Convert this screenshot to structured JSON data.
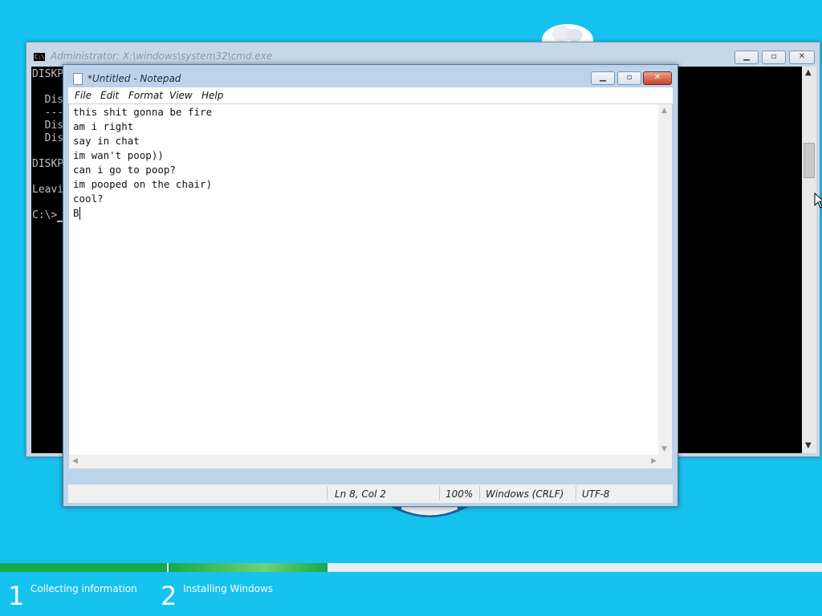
{
  "cmd": {
    "title": "Administrator: X:\\windows\\system32\\cmd.exe",
    "icon": "console-icon",
    "lines": [
      "DISKP",
      "",
      "  Dis",
      "  ---",
      "  Dis",
      "  Dis",
      "",
      "DISKP",
      "",
      "Leavi",
      "",
      "C:\\>"
    ]
  },
  "notepad": {
    "title": "*Untitled - Notepad",
    "menu": [
      "File",
      "Edit",
      "Format",
      "View",
      "Help"
    ],
    "text_lines": [
      "this shit gonna be fire",
      "am i right",
      "say in chat",
      "im wan't poop))",
      "can i go to poop?",
      "im pooped on the chair)",
      "cool?",
      "B"
    ],
    "status": {
      "position": "Ln 8, Col 2",
      "zoom": "100%",
      "line_ending": "Windows (CRLF)",
      "encoding": "UTF-8"
    }
  },
  "setup": {
    "progress_steps_complete": 2,
    "steps": [
      {
        "number": "1",
        "label": "Collecting information"
      },
      {
        "number": "2",
        "label": "Installing Windows"
      }
    ]
  },
  "colors": {
    "desktop": "#16c2ee",
    "progress_green": "#17a84a",
    "close_red": "#c8412a"
  }
}
